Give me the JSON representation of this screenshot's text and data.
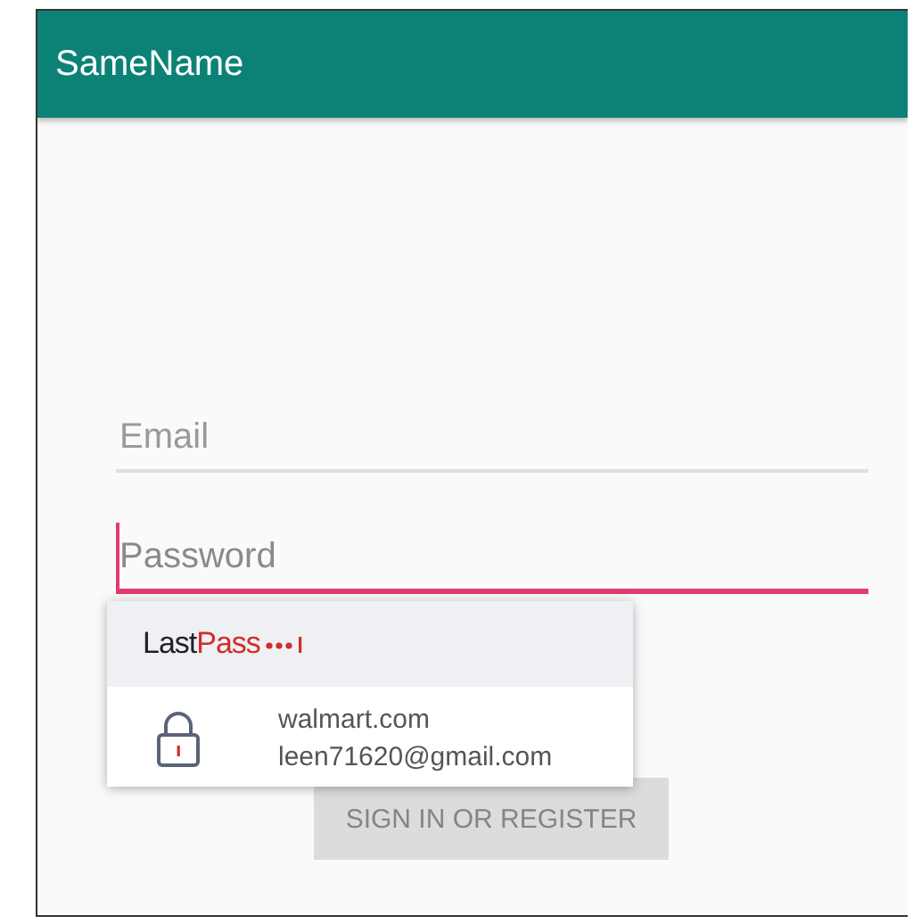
{
  "app_bar": {
    "title": "SameName"
  },
  "fields": [
    {
      "placeholder": "Email",
      "focused": false
    },
    {
      "placeholder": "Password",
      "focused": true
    }
  ],
  "button": {
    "label": "SIGN IN OR REGISTER",
    "disabled": true
  },
  "autofill_popup": {
    "logo": {
      "first": "Last",
      "second": "Pass"
    },
    "entries": [
      {
        "site": "walmart.com",
        "username": "leen71620@gmail.com"
      }
    ]
  }
}
